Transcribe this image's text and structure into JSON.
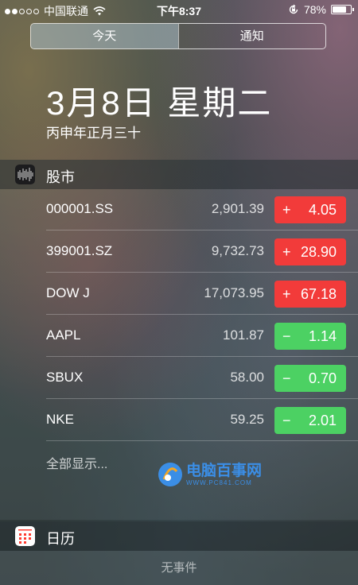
{
  "status_bar": {
    "signal_dots_filled": 2,
    "signal_dots_total": 5,
    "carrier": "中国联通",
    "time": "下午8:37",
    "battery": "78%",
    "battery_level": 0.78
  },
  "tabs": [
    {
      "label": "今天",
      "active": true
    },
    {
      "label": "通知",
      "active": false
    }
  ],
  "date": {
    "main": "3月8日 星期二",
    "lunar": "丙申年正月三十"
  },
  "stocks_widget": {
    "title": "股市",
    "rows": [
      {
        "symbol": "000001.SS",
        "price": "2,901.39",
        "sign": "+",
        "change": "4.05",
        "direction": "up"
      },
      {
        "symbol": "399001.SZ",
        "price": "9,732.73",
        "sign": "+",
        "change": "28.90",
        "direction": "up"
      },
      {
        "symbol": "DOW J",
        "price": "17,073.95",
        "sign": "+",
        "change": "67.18",
        "direction": "up"
      },
      {
        "symbol": "AAPL",
        "price": "101.87",
        "sign": "−",
        "change": "1.14",
        "direction": "down"
      },
      {
        "symbol": "SBUX",
        "price": "58.00",
        "sign": "−",
        "change": "0.70",
        "direction": "down"
      },
      {
        "symbol": "NKE",
        "price": "59.25",
        "sign": "−",
        "change": "2.01",
        "direction": "down"
      }
    ],
    "show_all": "全部显示..."
  },
  "calendar_widget": {
    "title": "日历",
    "empty_text": "无事件"
  },
  "watermark": {
    "main": "电脑百事网",
    "sub": "WWW.PC841.COM"
  },
  "colors": {
    "up": "#f23b3a",
    "down": "#4cd163",
    "watermark": "#3b8ee6"
  },
  "icons": {
    "stocks": "stocks-icon",
    "calendar": "calendar-icon",
    "wifi": "wifi-icon",
    "orientation_lock": "orientation-lock-icon",
    "battery": "battery-icon"
  }
}
